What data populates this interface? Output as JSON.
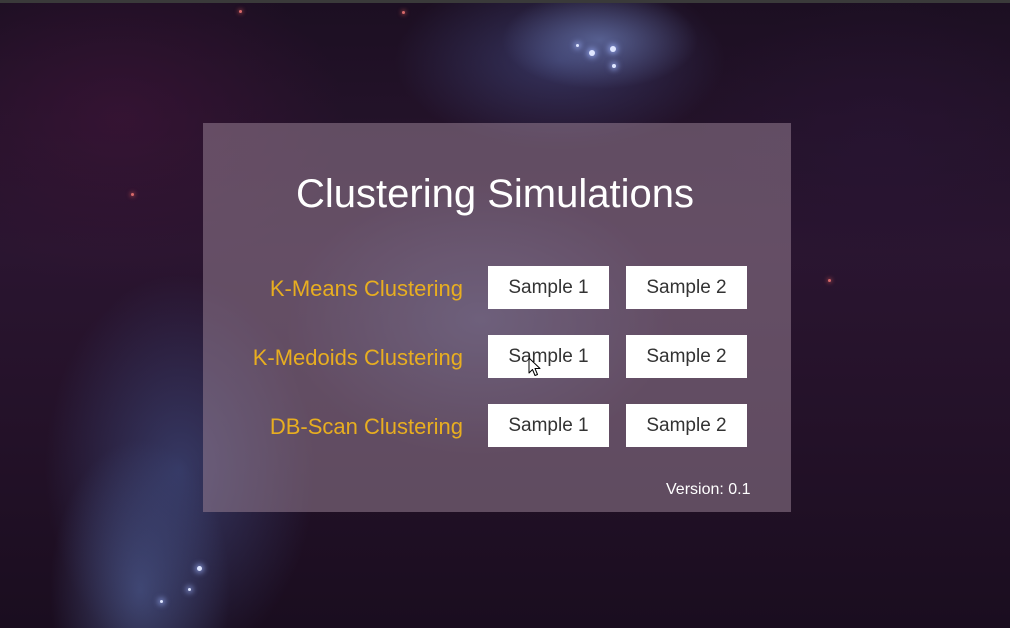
{
  "title": "Clustering Simulations",
  "version_text": "Version: 0.1",
  "rows": [
    {
      "label": "K-Means Clustering",
      "sample1": "Sample 1",
      "sample2": "Sample 2"
    },
    {
      "label": "K-Medoids Clustering",
      "sample1": "Sample 1",
      "sample2": "Sample 2"
    },
    {
      "label": "DB-Scan Clustering",
      "sample1": "Sample 1",
      "sample2": "Sample 2"
    }
  ],
  "colors": {
    "label": "#e8ae20",
    "title": "#ffffff",
    "button_bg": "#ffffff",
    "button_text": "#333333"
  },
  "icons": {
    "cursor": "mouse-pointer-icon"
  }
}
